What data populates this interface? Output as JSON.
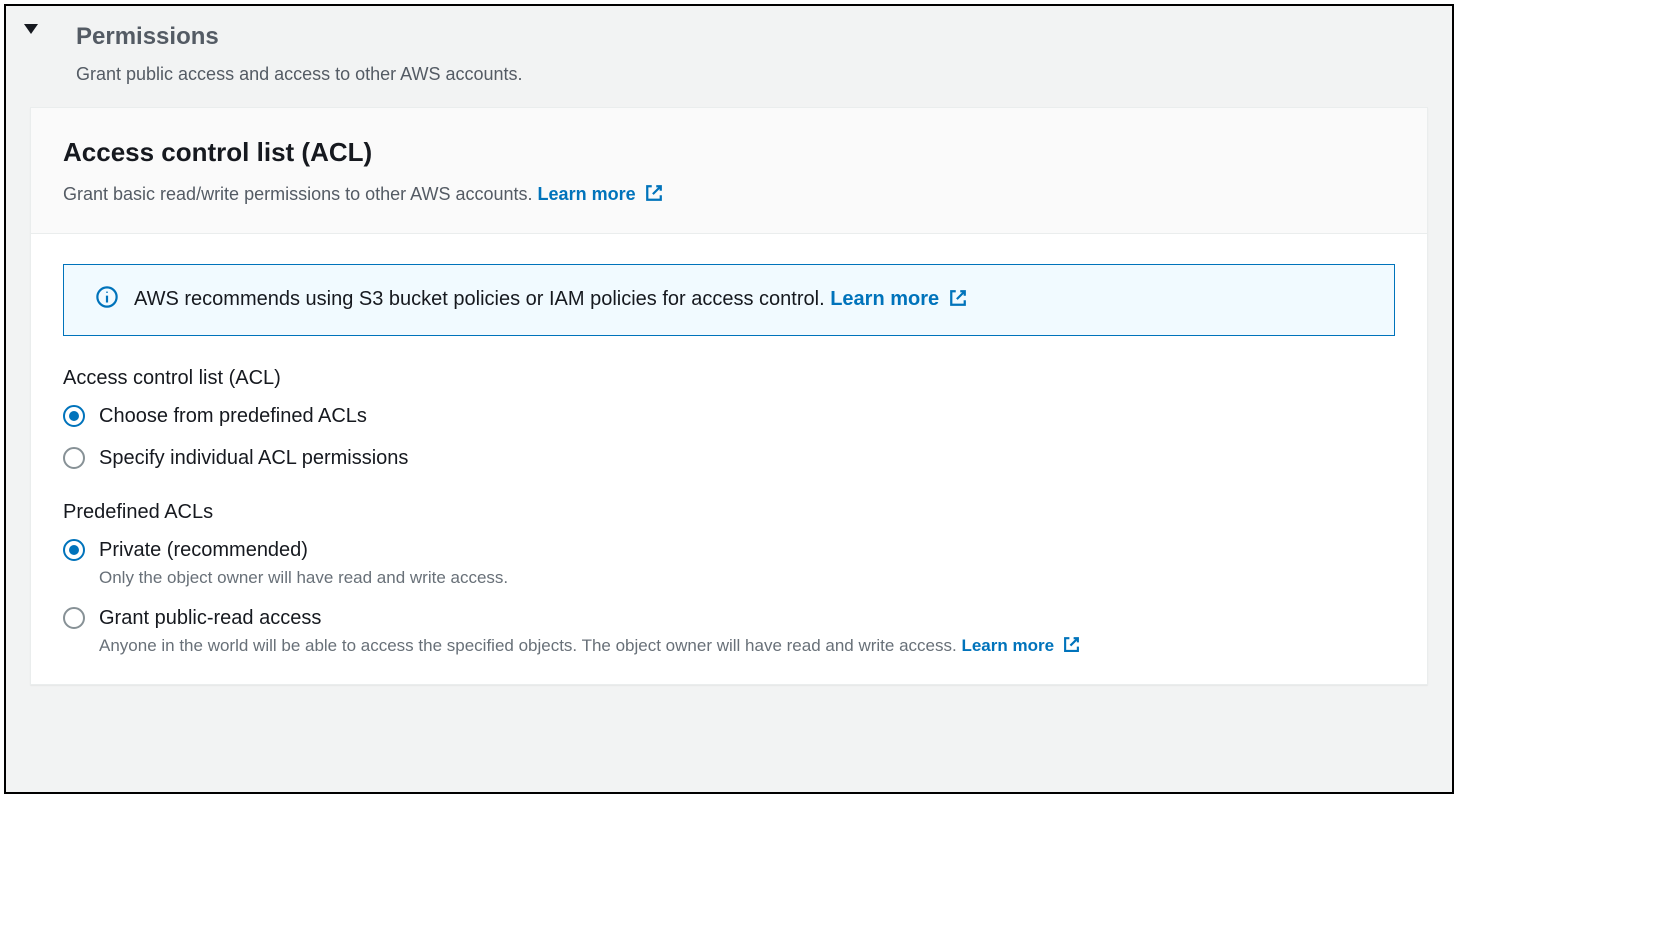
{
  "section": {
    "title": "Permissions",
    "subtitle": "Grant public access and access to other AWS accounts."
  },
  "panel": {
    "title": "Access control list (ACL)",
    "desc": "Grant basic read/write permissions to other AWS accounts.",
    "learn_more": "Learn more"
  },
  "info": {
    "text": "AWS recommends using S3 bucket policies or IAM policies for access control.",
    "learn_more": "Learn more"
  },
  "acl_group": {
    "label": "Access control list (ACL)",
    "options": {
      "predefined": "Choose from predefined ACLs",
      "individual": "Specify individual ACL permissions"
    }
  },
  "predefined_group": {
    "label": "Predefined ACLs",
    "private": {
      "label": "Private (recommended)",
      "desc": "Only the object owner will have read and write access."
    },
    "public_read": {
      "label": "Grant public-read access",
      "desc": "Anyone in the world will be able to access the specified objects. The object owner will have read and write access.",
      "learn_more": "Learn more"
    }
  }
}
